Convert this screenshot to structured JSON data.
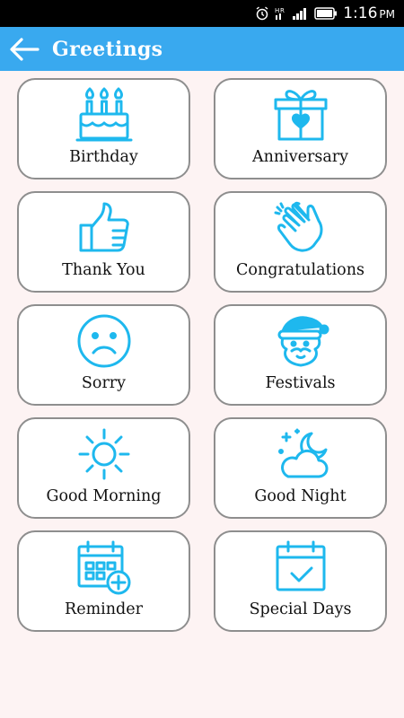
{
  "status": {
    "time": "1:16",
    "ampm": "PM",
    "icons": [
      "alarm-icon",
      "hr-signal-icon",
      "cell-signal-icon",
      "battery-icon"
    ]
  },
  "appbar": {
    "title": "Greetings",
    "back_icon": "arrow-left-icon",
    "color": "#39a9ef"
  },
  "icon_color": "#1eb8ee",
  "cards": [
    {
      "label": "Birthday",
      "icon": "birthday-cake-icon"
    },
    {
      "label": "Anniversary",
      "icon": "gift-box-icon"
    },
    {
      "label": "Thank You",
      "icon": "thumbs-up-icon"
    },
    {
      "label": "Congratulations",
      "icon": "clapping-hands-icon"
    },
    {
      "label": "Sorry",
      "icon": "sad-face-icon"
    },
    {
      "label": "Festivals",
      "icon": "santa-icon"
    },
    {
      "label": "Good Morning",
      "icon": "sun-icon"
    },
    {
      "label": "Good Night",
      "icon": "moon-cloud-icon"
    },
    {
      "label": "Reminder",
      "icon": "calendar-add-icon"
    },
    {
      "label": "Special Days",
      "icon": "calendar-check-icon"
    }
  ]
}
